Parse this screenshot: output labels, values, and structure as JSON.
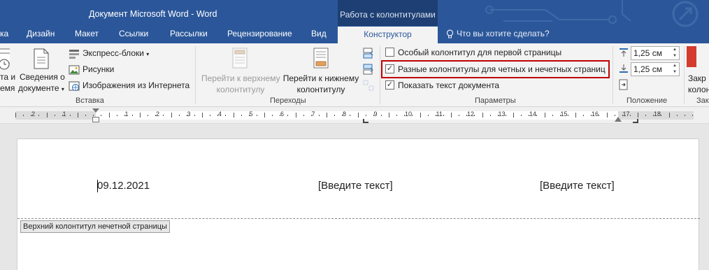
{
  "window": {
    "title": "Документ Microsoft Word - Word",
    "context_tab": "Работа с колонтитулами"
  },
  "tabs": {
    "file_partial": "ка",
    "design": "Дизайн",
    "layout": "Макет",
    "references": "Ссылки",
    "mailings": "Рассылки",
    "review": "Рецензирование",
    "view": "Вид",
    "constructor": "Конструктор",
    "tell_me": "Что вы хотите сделать?"
  },
  "ribbon": {
    "insert": {
      "date_time_partial_1": "та и",
      "date_time_partial_2": "емя",
      "doc_info_1": "Сведения о",
      "doc_info_2": "документе",
      "express_blocks": "Экспресс-блоки",
      "pictures": "Рисунки",
      "online_pictures": "Изображения из Интернета",
      "group_label": "Вставка"
    },
    "navigation": {
      "goto_header_1": "Перейти к верхнему",
      "goto_header_2": "колонтитулу",
      "goto_footer_1": "Перейти к нижнему",
      "goto_footer_2": "колонтитулу",
      "group_label": "Переходы"
    },
    "options": {
      "first_page": "Особый колонтитул для первой страницы",
      "first_page_checked": false,
      "odd_even": "Разные колонтитулы для четных и нечетных страниц",
      "odd_even_checked": true,
      "show_text": "Показать текст документа",
      "show_text_checked": true,
      "group_label": "Параметры",
      "check_glyph": "✓"
    },
    "position": {
      "header_from_top": "1,25 см",
      "footer_from_bottom": "1,25 см",
      "group_label": "Положение"
    },
    "close": {
      "label_partial_1": "Закр",
      "label_partial_2": "колон",
      "group_partial": "Зак"
    }
  },
  "ruler": {
    "numbers": [
      "2",
      "1",
      "1",
      "2",
      "3",
      "4",
      "5",
      "6",
      "7",
      "8",
      "9",
      "10",
      "11",
      "12",
      "13",
      "14",
      "15",
      "16",
      "17",
      "18"
    ]
  },
  "page": {
    "header_left": "09.12.2021",
    "header_center": "[Введите текст]",
    "header_right": "[Введите текст]",
    "header_tag": "Верхний колонтитул нечетной страницы"
  },
  "colors": {
    "title_bar": "#2b579a",
    "context_tab": "#1e3f73",
    "highlight_box": "#c00000"
  }
}
